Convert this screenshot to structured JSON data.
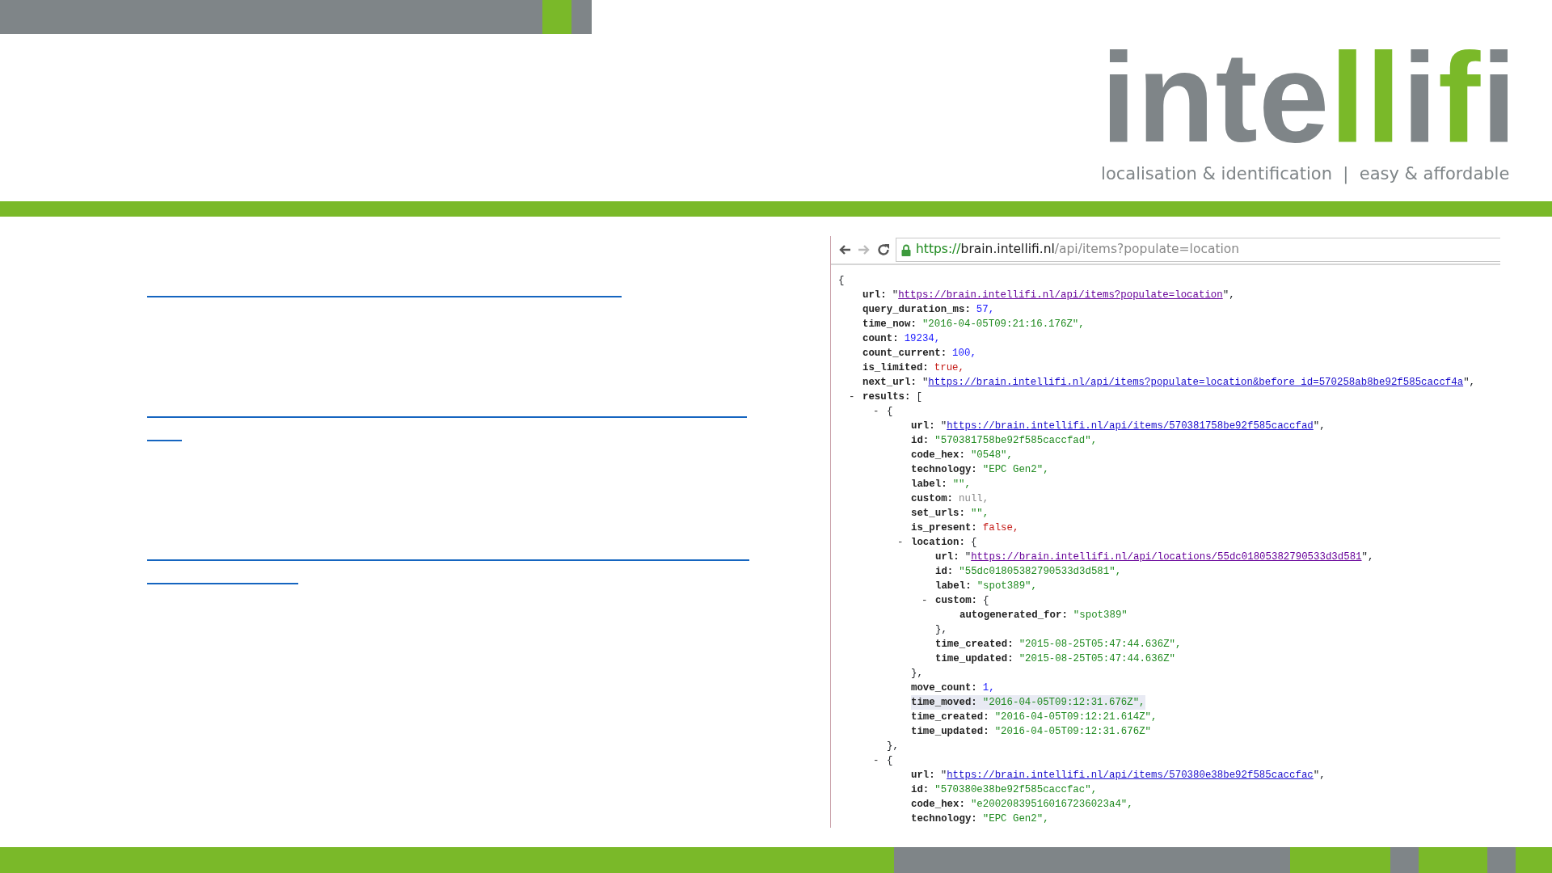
{
  "header": {
    "logo": [
      {
        "text": "inte",
        "color": "#7f8588"
      },
      {
        "text": "ll",
        "color": "#7ab929"
      },
      {
        "text": "i",
        "color": "#7f8588"
      },
      {
        "text": "f",
        "color": "#7ab929"
      },
      {
        "text": "i",
        "color": "#7f8588"
      }
    ],
    "tagline": "localisation & identification  |  easy & affordable"
  },
  "browser": {
    "back_enabled": true,
    "forward_enabled": false,
    "address": {
      "scheme": "https://",
      "host": "brain.intellifi.nl",
      "path": "/api/items?populate=location"
    },
    "document": {
      "kind": "object",
      "open": "{",
      "children": [
        {
          "kind": "link",
          "key": "url:",
          "visited": true,
          "before": "\"",
          "value": "https://brain.intellifi.nl/api/items?populate=location",
          "after": "\",",
          "highlighted": false
        },
        {
          "kind": "number",
          "key": "query_duration_ms:",
          "value": "57,",
          "highlighted": false
        },
        {
          "kind": "string",
          "key": "time_now:",
          "value": "\"2016-04-05T09:21:16.176Z\",",
          "highlighted": false
        },
        {
          "kind": "number",
          "key": "count:",
          "value": "19234,",
          "highlighted": false
        },
        {
          "kind": "number",
          "key": "count_current:",
          "value": "100,",
          "highlighted": false
        },
        {
          "kind": "boolean",
          "key": "is_limited:",
          "value": "true,",
          "highlighted": false
        },
        {
          "kind": "link",
          "key": "next_url:",
          "visited": false,
          "before": "\"",
          "value": "https://brain.intellifi.nl/api/items?populate=location&before_id=570258ab8be92f585caccf4a",
          "after": "\",",
          "highlighted": false
        },
        {
          "kind": "object",
          "toggle": "-",
          "key": "results:",
          "open": "[",
          "children": [
            {
              "kind": "object",
              "toggle": "-",
              "open": "{",
              "close": "},",
              "children": [
                {
                  "kind": "link",
                  "key": "url:",
                  "visited": false,
                  "before": "\"",
                  "value": "https://brain.intellifi.nl/api/items/570381758be92f585caccfad",
                  "after": "\",",
                  "highlighted": false
                },
                {
                  "kind": "string",
                  "key": "id:",
                  "value": "\"570381758be92f585caccfad\",",
                  "highlighted": false
                },
                {
                  "kind": "string",
                  "key": "code_hex:",
                  "value": "\"0548\",",
                  "highlighted": false
                },
                {
                  "kind": "string",
                  "key": "technology:",
                  "value": "\"EPC Gen2\",",
                  "highlighted": false
                },
                {
                  "kind": "string",
                  "key": "label:",
                  "value": "\"\",",
                  "highlighted": false
                },
                {
                  "kind": "null",
                  "key": "custom:",
                  "value": "null,",
                  "highlighted": false
                },
                {
                  "kind": "string",
                  "key": "set_urls:",
                  "value": "\"\",",
                  "highlighted": false
                },
                {
                  "kind": "boolean",
                  "key": "is_present:",
                  "value": "false,",
                  "highlighted": false
                },
                {
                  "kind": "object",
                  "toggle": "-",
                  "key": "location:",
                  "open": "{",
                  "close": "},",
                  "children": [
                    {
                      "kind": "link",
                      "key": "url:",
                      "visited": true,
                      "before": "\"",
                      "value": "https://brain.intellifi.nl/api/locations/55dc01805382790533d3d581",
                      "after": "\",",
                      "highlighted": false
                    },
                    {
                      "kind": "string",
                      "key": "id:",
                      "value": "\"55dc01805382790533d3d581\",",
                      "highlighted": false
                    },
                    {
                      "kind": "string",
                      "key": "label:",
                      "value": "\"spot389\",",
                      "highlighted": false
                    },
                    {
                      "kind": "object",
                      "toggle": "-",
                      "key": "custom:",
                      "open": "{",
                      "close": "},",
                      "children": [
                        {
                          "kind": "string",
                          "key": "autogenerated_for:",
                          "value": "\"spot389\"",
                          "highlighted": false
                        }
                      ]
                    },
                    {
                      "kind": "string",
                      "key": "time_created:",
                      "value": "\"2015-08-25T05:47:44.636Z\",",
                      "highlighted": false
                    },
                    {
                      "kind": "string",
                      "key": "time_updated:",
                      "value": "\"2015-08-25T05:47:44.636Z\"",
                      "highlighted": false
                    }
                  ]
                },
                {
                  "kind": "number",
                  "key": "move_count:",
                  "value": "1,",
                  "highlighted": false
                },
                {
                  "kind": "string",
                  "key": "time_moved:",
                  "value": "\"2016-04-05T09:12:31.676Z\",",
                  "highlighted": true
                },
                {
                  "kind": "string",
                  "key": "time_created:",
                  "value": "\"2016-04-05T09:12:21.614Z\",",
                  "highlighted": false
                },
                {
                  "kind": "string",
                  "key": "time_updated:",
                  "value": "\"2016-04-05T09:12:31.676Z\"",
                  "highlighted": false
                }
              ]
            },
            {
              "kind": "object",
              "toggle": "-",
              "open": "{",
              "children": [
                {
                  "kind": "link",
                  "key": "url:",
                  "visited": false,
                  "before": "\"",
                  "value": "https://brain.intellifi.nl/api/items/570380e38be92f585caccfac",
                  "after": "\",",
                  "highlighted": false
                },
                {
                  "kind": "string",
                  "key": "id:",
                  "value": "\"570380e38be92f585caccfac\",",
                  "highlighted": false
                },
                {
                  "kind": "string",
                  "key": "code_hex:",
                  "value": "\"e200208395160167236023a4\",",
                  "highlighted": false
                },
                {
                  "kind": "string",
                  "key": "technology:",
                  "value": "\"EPC Gen2\",",
                  "highlighted": false
                }
              ]
            }
          ]
        }
      ]
    }
  }
}
